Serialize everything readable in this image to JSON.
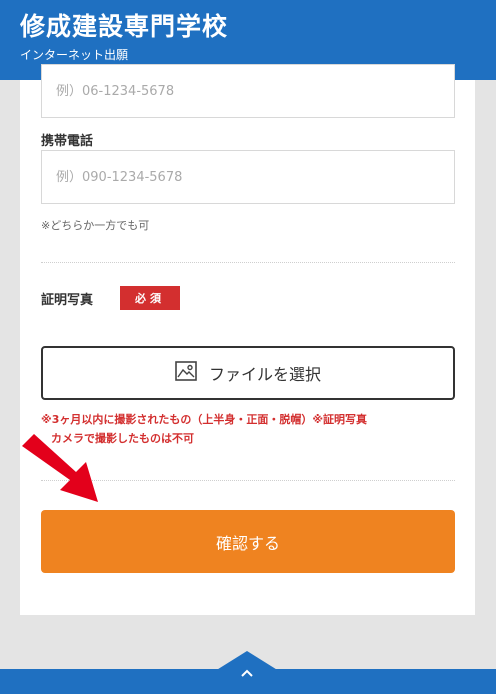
{
  "header": {
    "title": "修成建設専門学校",
    "subtitle": "インターネット出願"
  },
  "form": {
    "phone_placeholder": "例）06-1234-5678",
    "mobile_label": "携帯電話",
    "mobile_placeholder": "例）090-1234-5678",
    "phone_note": "※どちらか一方でも可",
    "photo_label": "証明写真",
    "required_badge": "必須",
    "file_button_label": "ファイルを選択",
    "photo_note_line1": "※3ヶ月以内に撮影されたもの（上半身・正面・脱帽）※証明写真",
    "photo_note_line2": "カメラで撮影したものは不可",
    "confirm_button_label": "確認する"
  },
  "icons": {
    "file": "image-file-icon",
    "pointer": "red-arrow-icon",
    "scroll": "chevron-up-icon"
  },
  "colors": {
    "brand_blue": "#1f70c1",
    "confirm_orange": "#ef8320",
    "required_red": "#d32f2f"
  }
}
